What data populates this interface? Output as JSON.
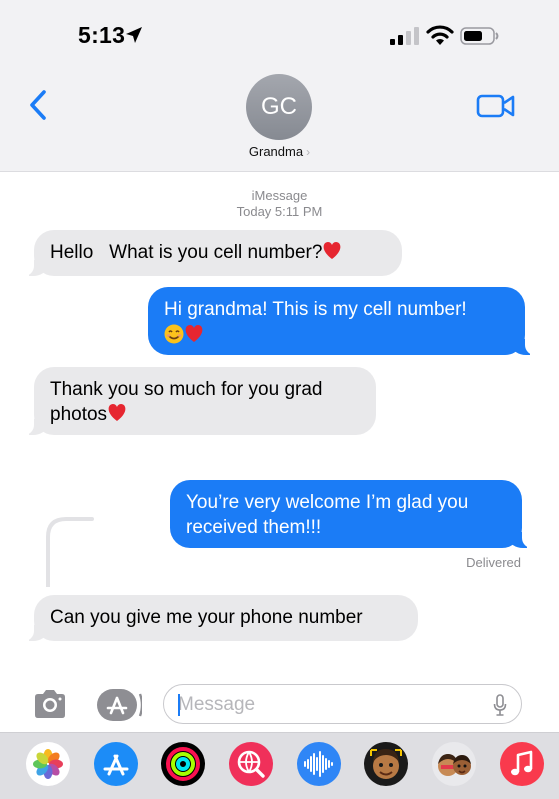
{
  "status_bar": {
    "time": "5:13"
  },
  "header": {
    "avatar_initials": "GC",
    "contact_name": "Grandma",
    "contact_chevron": "›"
  },
  "meta": {
    "service": "iMessage",
    "timestamp": "Today 5:11 PM"
  },
  "messages": [
    {
      "direction": "incoming",
      "text": "Hello   What is you cell number?",
      "emoji": [
        "red-heart"
      ]
    },
    {
      "direction": "outgoing",
      "text": "Hi grandma! This is my cell number!",
      "emoji": [
        "smiling-face",
        "red-heart"
      ]
    },
    {
      "direction": "incoming",
      "text_line1": "Thank you so much for you grad",
      "text_line2": "photos",
      "emoji": [
        "red-heart"
      ]
    },
    {
      "direction": "outgoing",
      "text_line1": "You’re very welcome I’m glad you",
      "text_line2": "received them!!!"
    },
    {
      "direction": "incoming",
      "text": "Can you give me your phone number"
    }
  ],
  "delivered_label": "Delivered",
  "input": {
    "placeholder": "Message"
  },
  "app_drawer": [
    {
      "name": "photos",
      "color": "#ffffff"
    },
    {
      "name": "app-store",
      "color": "#1c8cf7"
    },
    {
      "name": "activity",
      "color": "#000000"
    },
    {
      "name": "images-search",
      "color": "#f0305a"
    },
    {
      "name": "audio-message",
      "color": "#2f86f6"
    },
    {
      "name": "memoji",
      "color": "#1a1a1a"
    },
    {
      "name": "memoji-stickers",
      "color": "#e9e9ec"
    },
    {
      "name": "music",
      "color": "#f93a4d"
    }
  ],
  "colors": {
    "outgoing_bubble": "#1b7cf6",
    "incoming_bubble": "#e9e9eb",
    "accent": "#1b7cf6"
  }
}
